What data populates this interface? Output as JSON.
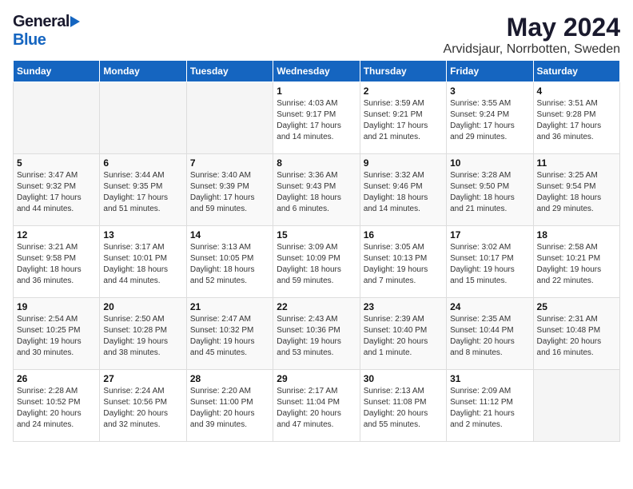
{
  "header": {
    "logo_general": "General",
    "logo_blue": "Blue",
    "main_title": "May 2024",
    "subtitle": "Arvidsjaur, Norrbotten, Sweden"
  },
  "days_of_week": [
    "Sunday",
    "Monday",
    "Tuesday",
    "Wednesday",
    "Thursday",
    "Friday",
    "Saturday"
  ],
  "weeks": [
    {
      "days": [
        {
          "num": "",
          "info": ""
        },
        {
          "num": "",
          "info": ""
        },
        {
          "num": "",
          "info": ""
        },
        {
          "num": "1",
          "info": "Sunrise: 4:03 AM\nSunset: 9:17 PM\nDaylight: 17 hours\nand 14 minutes."
        },
        {
          "num": "2",
          "info": "Sunrise: 3:59 AM\nSunset: 9:21 PM\nDaylight: 17 hours\nand 21 minutes."
        },
        {
          "num": "3",
          "info": "Sunrise: 3:55 AM\nSunset: 9:24 PM\nDaylight: 17 hours\nand 29 minutes."
        },
        {
          "num": "4",
          "info": "Sunrise: 3:51 AM\nSunset: 9:28 PM\nDaylight: 17 hours\nand 36 minutes."
        }
      ]
    },
    {
      "days": [
        {
          "num": "5",
          "info": "Sunrise: 3:47 AM\nSunset: 9:32 PM\nDaylight: 17 hours\nand 44 minutes."
        },
        {
          "num": "6",
          "info": "Sunrise: 3:44 AM\nSunset: 9:35 PM\nDaylight: 17 hours\nand 51 minutes."
        },
        {
          "num": "7",
          "info": "Sunrise: 3:40 AM\nSunset: 9:39 PM\nDaylight: 17 hours\nand 59 minutes."
        },
        {
          "num": "8",
          "info": "Sunrise: 3:36 AM\nSunset: 9:43 PM\nDaylight: 18 hours\nand 6 minutes."
        },
        {
          "num": "9",
          "info": "Sunrise: 3:32 AM\nSunset: 9:46 PM\nDaylight: 18 hours\nand 14 minutes."
        },
        {
          "num": "10",
          "info": "Sunrise: 3:28 AM\nSunset: 9:50 PM\nDaylight: 18 hours\nand 21 minutes."
        },
        {
          "num": "11",
          "info": "Sunrise: 3:25 AM\nSunset: 9:54 PM\nDaylight: 18 hours\nand 29 minutes."
        }
      ]
    },
    {
      "days": [
        {
          "num": "12",
          "info": "Sunrise: 3:21 AM\nSunset: 9:58 PM\nDaylight: 18 hours\nand 36 minutes."
        },
        {
          "num": "13",
          "info": "Sunrise: 3:17 AM\nSunset: 10:01 PM\nDaylight: 18 hours\nand 44 minutes."
        },
        {
          "num": "14",
          "info": "Sunrise: 3:13 AM\nSunset: 10:05 PM\nDaylight: 18 hours\nand 52 minutes."
        },
        {
          "num": "15",
          "info": "Sunrise: 3:09 AM\nSunset: 10:09 PM\nDaylight: 18 hours\nand 59 minutes."
        },
        {
          "num": "16",
          "info": "Sunrise: 3:05 AM\nSunset: 10:13 PM\nDaylight: 19 hours\nand 7 minutes."
        },
        {
          "num": "17",
          "info": "Sunrise: 3:02 AM\nSunset: 10:17 PM\nDaylight: 19 hours\nand 15 minutes."
        },
        {
          "num": "18",
          "info": "Sunrise: 2:58 AM\nSunset: 10:21 PM\nDaylight: 19 hours\nand 22 minutes."
        }
      ]
    },
    {
      "days": [
        {
          "num": "19",
          "info": "Sunrise: 2:54 AM\nSunset: 10:25 PM\nDaylight: 19 hours\nand 30 minutes."
        },
        {
          "num": "20",
          "info": "Sunrise: 2:50 AM\nSunset: 10:28 PM\nDaylight: 19 hours\nand 38 minutes."
        },
        {
          "num": "21",
          "info": "Sunrise: 2:47 AM\nSunset: 10:32 PM\nDaylight: 19 hours\nand 45 minutes."
        },
        {
          "num": "22",
          "info": "Sunrise: 2:43 AM\nSunset: 10:36 PM\nDaylight: 19 hours\nand 53 minutes."
        },
        {
          "num": "23",
          "info": "Sunrise: 2:39 AM\nSunset: 10:40 PM\nDaylight: 20 hours\nand 1 minute."
        },
        {
          "num": "24",
          "info": "Sunrise: 2:35 AM\nSunset: 10:44 PM\nDaylight: 20 hours\nand 8 minutes."
        },
        {
          "num": "25",
          "info": "Sunrise: 2:31 AM\nSunset: 10:48 PM\nDaylight: 20 hours\nand 16 minutes."
        }
      ]
    },
    {
      "days": [
        {
          "num": "26",
          "info": "Sunrise: 2:28 AM\nSunset: 10:52 PM\nDaylight: 20 hours\nand 24 minutes."
        },
        {
          "num": "27",
          "info": "Sunrise: 2:24 AM\nSunset: 10:56 PM\nDaylight: 20 hours\nand 32 minutes."
        },
        {
          "num": "28",
          "info": "Sunrise: 2:20 AM\nSunset: 11:00 PM\nDaylight: 20 hours\nand 39 minutes."
        },
        {
          "num": "29",
          "info": "Sunrise: 2:17 AM\nSunset: 11:04 PM\nDaylight: 20 hours\nand 47 minutes."
        },
        {
          "num": "30",
          "info": "Sunrise: 2:13 AM\nSunset: 11:08 PM\nDaylight: 20 hours\nand 55 minutes."
        },
        {
          "num": "31",
          "info": "Sunrise: 2:09 AM\nSunset: 11:12 PM\nDaylight: 21 hours\nand 2 minutes."
        },
        {
          "num": "",
          "info": ""
        }
      ]
    }
  ]
}
